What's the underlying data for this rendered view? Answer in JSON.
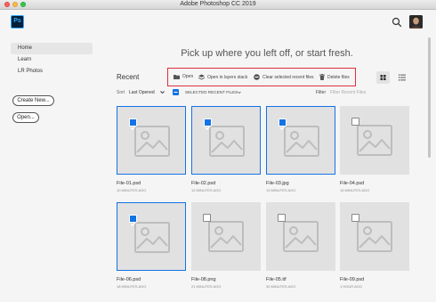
{
  "window": {
    "title": "Adobe Photoshop CC 2019"
  },
  "header": {
    "logo_text": "Ps"
  },
  "sidebar": {
    "items": [
      {
        "label": "Home",
        "active": true
      },
      {
        "label": "Learn",
        "active": false
      },
      {
        "label": "LR Photos",
        "active": false
      }
    ],
    "create_new_label": "Create New...",
    "open_label": "Open..."
  },
  "main": {
    "headline": "Pick up where you left off, or start fresh.",
    "recent_title": "Recent",
    "toolbar": {
      "open": "Open",
      "open_layers": "Open in layers stack",
      "clear": "Clear selected recent files",
      "delete": "Delete files"
    },
    "sort": {
      "label": "Sort",
      "value": "Last Opened",
      "selected_label": "SELECTED RECENT FILES"
    },
    "filter": {
      "label": "Filter",
      "placeholder": "Filter Recent Files"
    }
  },
  "files": [
    {
      "name": "File-01.psd",
      "time": "10 MINUTES AGO",
      "selected": true
    },
    {
      "name": "File-02.psd",
      "time": "12 MINUTES AGO",
      "selected": true
    },
    {
      "name": "File-03.jpg",
      "time": "13 MINUTES AGO",
      "selected": true
    },
    {
      "name": "File-04.psd",
      "time": "15 MINUTES AGO",
      "selected": false
    },
    {
      "name": "File-06.psd",
      "time": "18 MINUTES AGO",
      "selected": true
    },
    {
      "name": "File-08.png",
      "time": "21 MINUTES AGO",
      "selected": false
    },
    {
      "name": "File-05.tif",
      "time": "30 MINUTES AGO",
      "selected": false
    },
    {
      "name": "File-09.psd",
      "time": "1 HOUR AGO",
      "selected": false
    }
  ],
  "colors": {
    "accent": "#1473e6",
    "highlight_box": "#e0303a"
  }
}
